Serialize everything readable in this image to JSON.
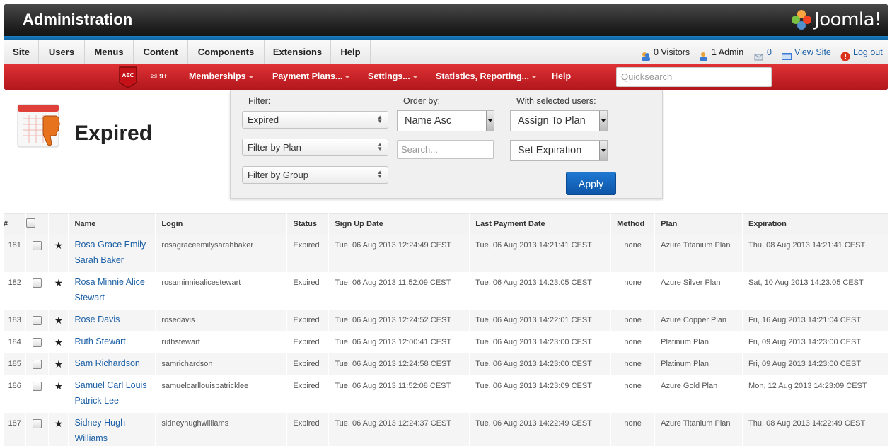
{
  "header": {
    "title": "Administration",
    "brand": "Joomla!"
  },
  "topmenu": {
    "items": [
      "Site",
      "Users",
      "Menus",
      "Content",
      "Components",
      "Extensions",
      "Help"
    ],
    "visitors": "0 Visitors",
    "admins": "1 Admin",
    "messages": "0",
    "view_site": "View Site",
    "logout": "Log out"
  },
  "submenu": {
    "logo": "AEC",
    "mail_badge": "9+",
    "items": [
      "Memberships",
      "Payment Plans...",
      "Settings...",
      "Statistics, Reporting...",
      "Help"
    ],
    "quicksearch_placeholder": "Quicksearch"
  },
  "page": {
    "title": "Expired"
  },
  "filters": {
    "filter_label": "Filter:",
    "status_value": "Expired",
    "plan_value": "Filter by Plan",
    "group_value": "Filter by Group",
    "order_label": "Order by:",
    "order_value": "Name Asc",
    "search_placeholder": "Search...",
    "selected_label": "With selected users:",
    "assign_value": "Assign To Plan",
    "expiration_value": "Set Expiration",
    "apply_label": "Apply"
  },
  "table": {
    "headers": [
      "#",
      "",
      "",
      "Name",
      "Login",
      "Status",
      "Sign Up Date",
      "Last Payment Date",
      "Method",
      "Plan",
      "Expiration"
    ],
    "rows": [
      {
        "num": "181",
        "name": "Rosa Grace Emily Sarah Baker",
        "login": "rosagraceemilysarahbaker",
        "status": "Expired",
        "signup": "Tue, 06 Aug 2013 12:24:49 CEST",
        "lastpay": "Tue, 06 Aug 2013 14:21:41 CEST",
        "method": "none",
        "plan": "Azure Titanium Plan",
        "expiration": "Thu, 08 Aug 2013 14:21:41 CEST"
      },
      {
        "num": "182",
        "name": "Rosa Minnie Alice Stewart",
        "login": "rosaminniealicestewart",
        "status": "Expired",
        "signup": "Tue, 06 Aug 2013 11:52:09 CEST",
        "lastpay": "Tue, 06 Aug 2013 14:23:05 CEST",
        "method": "none",
        "plan": "Azure Silver Plan",
        "expiration": "Sat, 10 Aug 2013 14:23:05 CEST"
      },
      {
        "num": "183",
        "name": "Rose Davis",
        "login": "rosedavis",
        "status": "Expired",
        "signup": "Tue, 06 Aug 2013 12:24:52 CEST",
        "lastpay": "Tue, 06 Aug 2013 14:22:01 CEST",
        "method": "none",
        "plan": "Azure Copper Plan",
        "expiration": "Fri, 16 Aug 2013 14:21:04 CEST"
      },
      {
        "num": "184",
        "name": "Ruth Stewart",
        "login": "ruthstewart",
        "status": "Expired",
        "signup": "Tue, 06 Aug 2013 12:00:41 CEST",
        "lastpay": "Tue, 06 Aug 2013 14:23:00 CEST",
        "method": "none",
        "plan": "Platinum Plan",
        "expiration": "Fri, 09 Aug 2013 14:23:00 CEST"
      },
      {
        "num": "185",
        "name": "Sam Richardson",
        "login": "samrichardson",
        "status": "Expired",
        "signup": "Tue, 06 Aug 2013 12:24:58 CEST",
        "lastpay": "Tue, 06 Aug 2013 14:23:00 CEST",
        "method": "none",
        "plan": "Platinum Plan",
        "expiration": "Fri, 09 Aug 2013 14:23:00 CEST"
      },
      {
        "num": "186",
        "name": "Samuel Carl Louis Patrick Lee",
        "login": "samuelcarllouispatricklee",
        "status": "Expired",
        "signup": "Tue, 06 Aug 2013 11:52:08 CEST",
        "lastpay": "Tue, 06 Aug 2013 14:23:09 CEST",
        "method": "none",
        "plan": "Azure Gold Plan",
        "expiration": "Mon, 12 Aug 2013 14:23:09 CEST"
      },
      {
        "num": "187",
        "name": "Sidney Hugh Williams",
        "login": "sidneyhughwilliams",
        "status": "Expired",
        "signup": "Tue, 06 Aug 2013 12:24:37 CEST",
        "lastpay": "Tue, 06 Aug 2013 14:22:49 CEST",
        "method": "none",
        "plan": "Azure Titanium Plan",
        "expiration": "Thu, 08 Aug 2013 14:22:49 CEST"
      }
    ]
  }
}
